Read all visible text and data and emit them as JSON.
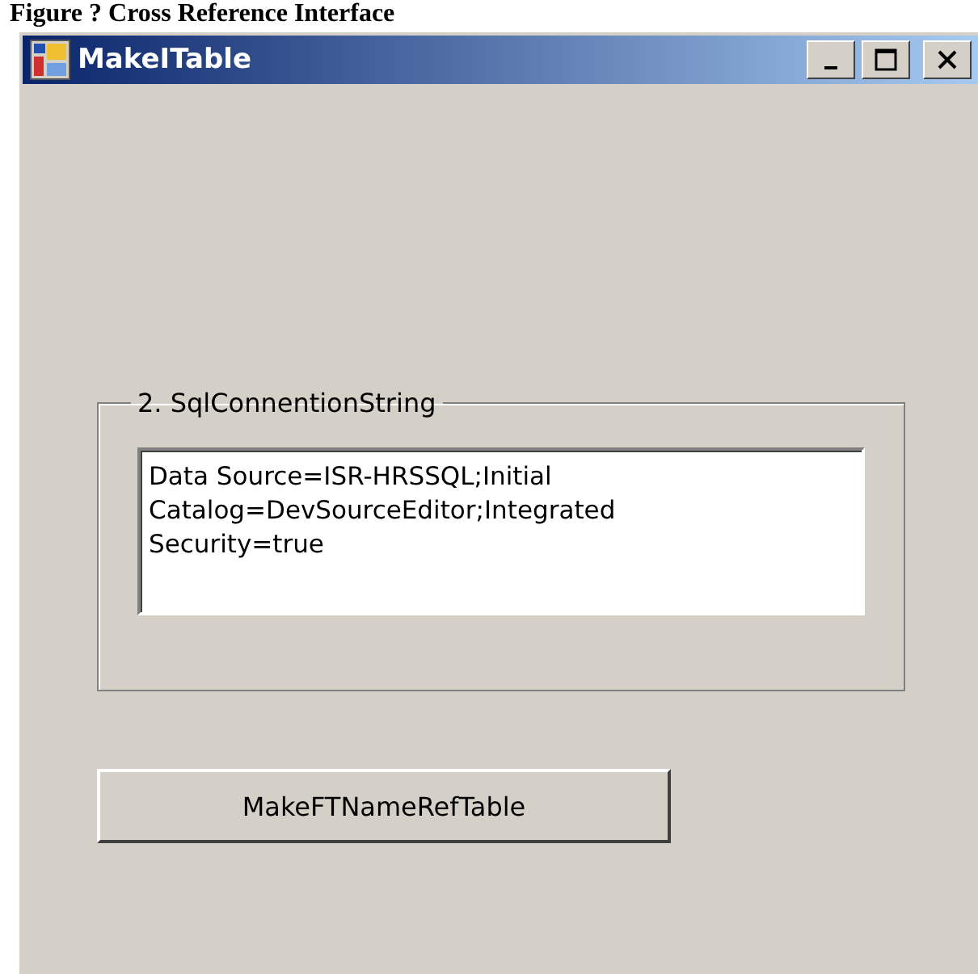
{
  "caption": "Figure ? Cross Reference Interface",
  "window": {
    "title": "MakeITable",
    "controls": [
      {
        "kind": "minimize"
      },
      {
        "kind": "maximize"
      },
      {
        "kind": "close"
      }
    ]
  },
  "group": {
    "label": "2. SqlConnentionString",
    "value_lines": [
      "Data Source=ISR-HRSSQL;Initial",
      "Catalog=DevSourceEditor;Integrated",
      "Security=true"
    ]
  },
  "buttons": [
    "MakeFTNameRefTable"
  ]
}
